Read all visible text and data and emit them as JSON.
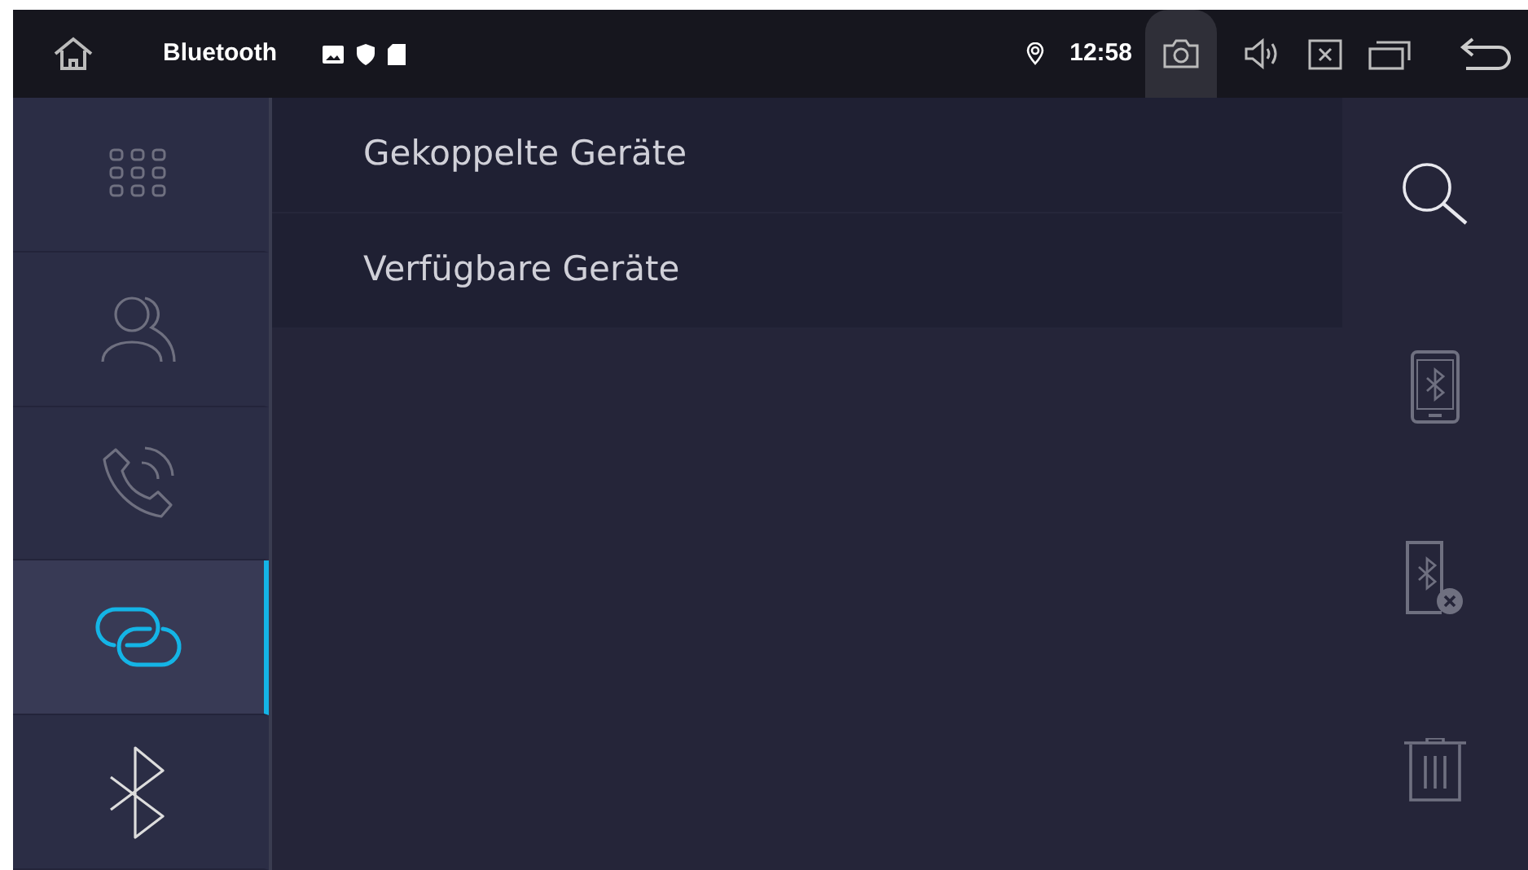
{
  "status_bar": {
    "title": "Bluetooth",
    "time": "12:58"
  },
  "sidebar": {
    "items": [
      {
        "kind": "apps",
        "selected": false
      },
      {
        "kind": "contacts",
        "selected": false
      },
      {
        "kind": "calls",
        "selected": false
      },
      {
        "kind": "link",
        "selected": true
      },
      {
        "kind": "bluetooth",
        "selected": false
      }
    ]
  },
  "list": {
    "items": [
      {
        "label": "Gekoppelte Geräte"
      },
      {
        "label": "Verfügbare Geräte"
      }
    ]
  },
  "actions": [
    {
      "kind": "search",
      "disabled": false
    },
    {
      "kind": "phone",
      "disabled": true
    },
    {
      "kind": "phone-remove",
      "disabled": true
    },
    {
      "kind": "delete",
      "disabled": true
    }
  ]
}
